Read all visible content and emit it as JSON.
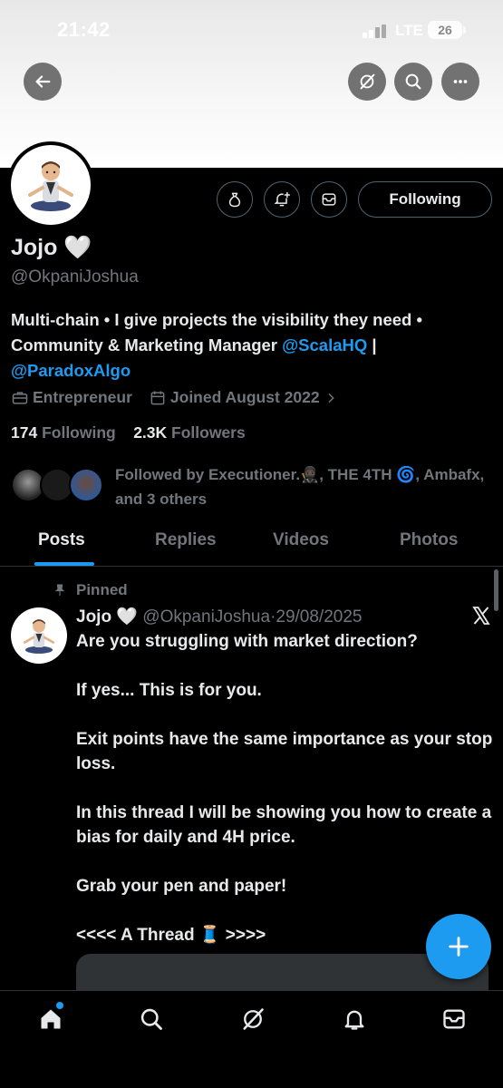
{
  "status_bar": {
    "time": "21:42",
    "network": "LTE",
    "battery": "26"
  },
  "profile": {
    "name": "Jojo",
    "name_emoji": "🤍",
    "handle": "@OkpaniJoshua",
    "bio_text": "Multi-chain • I give projects the visibility they need • Community & Marketing Manager ",
    "bio_link_1": "@ScalaHQ",
    "bio_separator": " |",
    "bio_link_2": "@ParadoxAlgo",
    "category": "Entrepreneur",
    "joined": "Joined August 2022",
    "following_count": "174",
    "following_label": "Following",
    "followers_count": "2.3K",
    "followers_label": "Followers",
    "followed_by": "Followed by Executioner.🥷🏿, THE 4TH 🌀, Ambafx, and 3 others",
    "follow_button": "Following"
  },
  "tabs": [
    {
      "label": "Posts"
    },
    {
      "label": "Replies"
    },
    {
      "label": "Videos"
    },
    {
      "label": "Photos"
    }
  ],
  "post": {
    "pinned_label": "Pinned",
    "author": "Jojo",
    "author_emoji": "🤍",
    "handle": "@OkpaniJoshua",
    "date": "29/08/2025",
    "lines": [
      "Are you struggling with market direction?",
      "If yes... This is for you.",
      "Exit points have the same importance as your stop loss.",
      "In this thread I will be showing you how to create a bias for daily and 4H price.",
      "Grab your pen and paper!",
      "<<<< A Thread 🧵 >>>>"
    ]
  },
  "colors": {
    "accent": "#1d9bf0",
    "background": "#000000",
    "muted": "#71767b",
    "text": "#e7e9ea"
  },
  "icons": [
    "back-arrow-icon",
    "grok-icon",
    "search-icon",
    "more-icon",
    "money-bag-icon",
    "notify-add-icon",
    "mail-icon",
    "briefcase-icon",
    "calendar-icon",
    "pin-icon",
    "x-logo-icon",
    "plus-icon",
    "home-icon",
    "bell-icon"
  ]
}
